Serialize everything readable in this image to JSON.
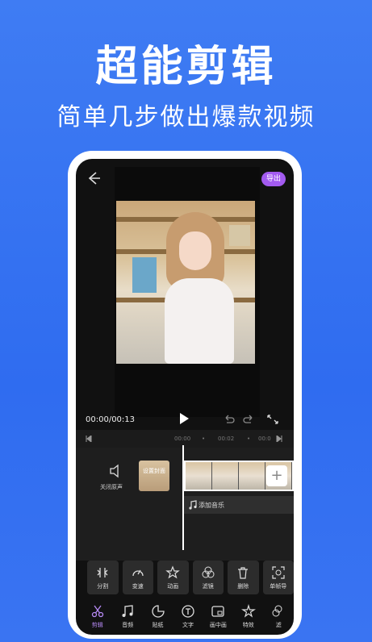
{
  "banner": {
    "headline": "超能剪辑",
    "subline": "简单几步做出爆款视频"
  },
  "editor": {
    "export_label": "导出",
    "time_display": "00:00/00:13",
    "ruler_ticks": [
      "00:00",
      "•",
      "00:02",
      "•",
      "00:0"
    ],
    "mute_label": "关闭原声",
    "cover_label": "设置封面",
    "music_label": "添加音乐"
  },
  "tools": [
    {
      "label": "分割",
      "icon": "split-icon"
    },
    {
      "label": "变速",
      "icon": "speed-icon"
    },
    {
      "label": "动画",
      "icon": "animation-icon"
    },
    {
      "label": "滤镜",
      "icon": "filter-icon"
    },
    {
      "label": "删除",
      "icon": "delete-icon"
    },
    {
      "label": "单帧导",
      "icon": "frame-export-icon"
    }
  ],
  "nav": [
    {
      "label": "剪辑",
      "icon": "scissors-icon",
      "active": true
    },
    {
      "label": "音频",
      "icon": "music-note-icon"
    },
    {
      "label": "贴纸",
      "icon": "sticker-icon"
    },
    {
      "label": "文字",
      "icon": "text-icon"
    },
    {
      "label": "画中画",
      "icon": "picture-in-picture-icon"
    },
    {
      "label": "特效",
      "icon": "effects-icon"
    },
    {
      "label": "滤",
      "icon": "filter-icon"
    }
  ],
  "colors": {
    "background": "#3f7cf3",
    "accent": "#a35bf0"
  }
}
